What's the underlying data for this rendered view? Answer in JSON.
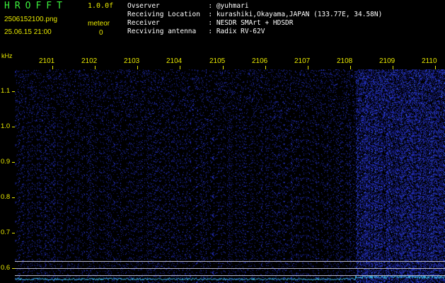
{
  "header": {
    "app_name": "HROFFT",
    "version": "1.0.0f",
    "filename": "2506152100.png",
    "datetime": "25.06.15 21:00",
    "meteor_label": "meteor",
    "meteor_count": "0"
  },
  "station": {
    "observer": "Ovserver            : @yuhmari",
    "location": "Receiving Location  : kurashiki,Okayama,JAPAN (133.77E, 34.58N)",
    "receiver": "Receiver            : NESDR SMArt + HDSDR",
    "antenna": "Recviving antenna   : Radix RV-62V"
  },
  "spectrogram": {
    "y_unit": "kHz",
    "y_ticks": [
      "1.1",
      "1.0",
      "0.9",
      "0.8",
      "0.7",
      "0.6"
    ],
    "x_ticks": [
      "2101",
      "2102",
      "2103",
      "2104",
      "2105",
      "2106",
      "2107",
      "2108",
      "2109",
      "2110"
    ],
    "colors": {
      "text": "#e8e800",
      "title": "#3cf03c",
      "background": "#000000",
      "noise": "#1a22c8",
      "trace": "#40c8ff"
    }
  }
}
